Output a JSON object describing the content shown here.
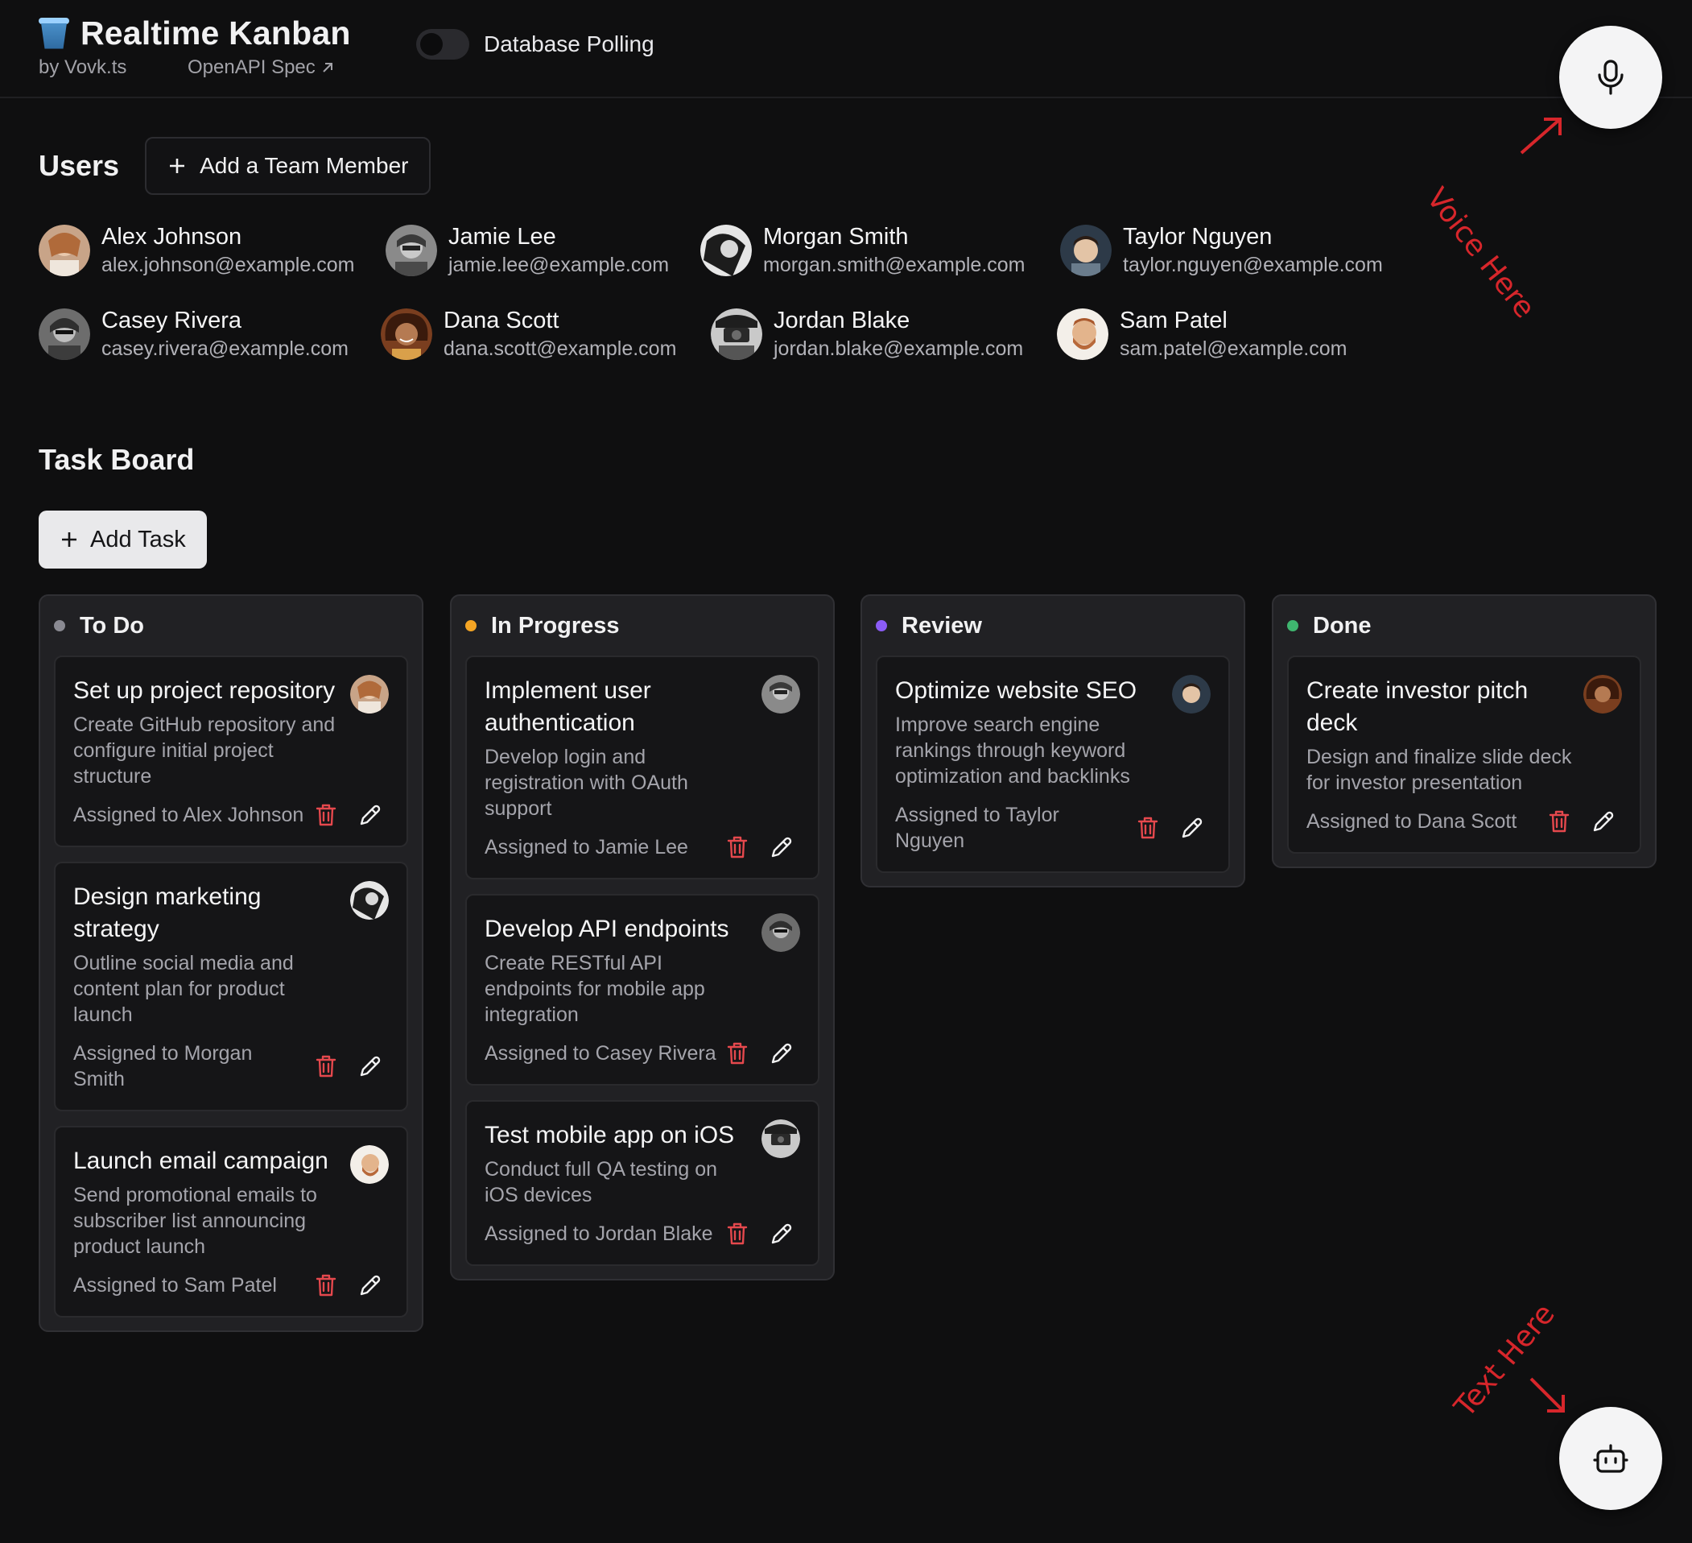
{
  "header": {
    "app_title": "Realtime Kanban",
    "by_label": "by Vovk.ts",
    "openapi_label": "OpenAPI Spec",
    "polling_label": "Database Polling",
    "polling_enabled": false
  },
  "annotations": {
    "voice": "Voice Here",
    "text": "Text Here",
    "color": "#d7262b"
  },
  "users_section": {
    "title": "Users",
    "add_button": "Add a Team Member",
    "users": [
      {
        "name": "Alex Johnson",
        "email": "alex.johnson@example.com"
      },
      {
        "name": "Jamie Lee",
        "email": "jamie.lee@example.com"
      },
      {
        "name": "Morgan Smith",
        "email": "morgan.smith@example.com"
      },
      {
        "name": "Taylor Nguyen",
        "email": "taylor.nguyen@example.com"
      },
      {
        "name": "Casey Rivera",
        "email": "casey.rivera@example.com"
      },
      {
        "name": "Dana Scott",
        "email": "dana.scott@example.com"
      },
      {
        "name": "Jordan Blake",
        "email": "jordan.blake@example.com"
      },
      {
        "name": "Sam Patel",
        "email": "sam.patel@example.com"
      }
    ]
  },
  "board": {
    "title": "Task Board",
    "add_task_button": "Add Task",
    "columns": [
      {
        "title": "To Do",
        "dot_color": "#8a8a92",
        "tasks": [
          {
            "title": "Set up project repository",
            "description": "Create GitHub repository and configure initial project structure",
            "assigned": "Assigned to Alex Johnson"
          },
          {
            "title": "Design marketing strategy",
            "description": "Outline social media and content plan for product launch",
            "assigned": "Assigned to Morgan Smith"
          },
          {
            "title": "Launch email campaign",
            "description": "Send promotional emails to subscriber list announcing product launch",
            "assigned": "Assigned to Sam Patel"
          }
        ]
      },
      {
        "title": "In Progress",
        "dot_color": "#f5a524",
        "tasks": [
          {
            "title": "Implement user authentication",
            "description": "Develop login and registration with OAuth support",
            "assigned": "Assigned to Jamie Lee"
          },
          {
            "title": "Develop API endpoints",
            "description": "Create RESTful API endpoints for mobile app integration",
            "assigned": "Assigned to Casey Rivera"
          },
          {
            "title": "Test mobile app on iOS",
            "description": "Conduct full QA testing on iOS devices",
            "assigned": "Assigned to Jordan Blake"
          }
        ]
      },
      {
        "title": "Review",
        "dot_color": "#8b5cf6",
        "tasks": [
          {
            "title": "Optimize website SEO",
            "description": "Improve search engine rankings through keyword optimization and backlinks",
            "assigned": "Assigned to Taylor Nguyen"
          }
        ]
      },
      {
        "title": "Done",
        "dot_color": "#3fb56f",
        "tasks": [
          {
            "title": "Create investor pitch deck",
            "description": "Design and finalize slide deck for investor presentation",
            "assigned": "Assigned to Dana Scott"
          }
        ]
      }
    ]
  },
  "colors": {
    "background": "#0f0f10",
    "card": "#151517",
    "column": "#212124",
    "delete_icon": "#e5484d"
  },
  "icons": {
    "mic": "microphone-icon",
    "bot": "robot-icon",
    "delete": "trash-icon",
    "edit": "pencil-icon",
    "add": "plus-icon",
    "external": "external-link-icon"
  }
}
